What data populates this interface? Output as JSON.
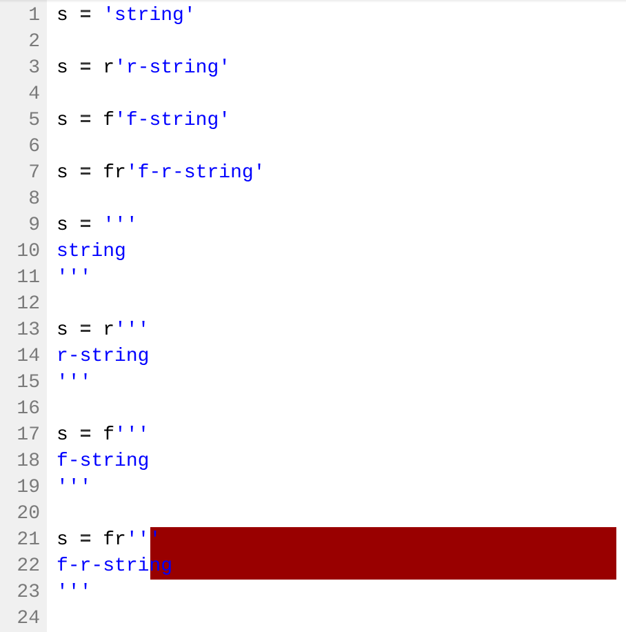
{
  "lineNumbers": [
    "1",
    "2",
    "3",
    "4",
    "5",
    "6",
    "7",
    "8",
    "9",
    "10",
    "11",
    "12",
    "13",
    "14",
    "15",
    "16",
    "17",
    "18",
    "19",
    "20",
    "21",
    "22",
    "23",
    "24"
  ],
  "code": {
    "line1": {
      "var": "s ",
      "op": "=",
      "prefix": " ",
      "str": "'string'"
    },
    "line3": {
      "var": "s ",
      "op": "=",
      "prefix": " r",
      "str": "'r-string'"
    },
    "line5": {
      "var": "s ",
      "op": "=",
      "prefix": " f",
      "str": "'f-string'"
    },
    "line7": {
      "var": "s ",
      "op": "=",
      "prefix": " fr",
      "str": "'f-r-string'"
    },
    "line9": {
      "var": "s ",
      "op": "=",
      "prefix": " ",
      "str": "'''"
    },
    "line10": {
      "str": "string"
    },
    "line11": {
      "str": "'''"
    },
    "line13": {
      "var": "s ",
      "op": "=",
      "prefix": " r",
      "str": "'''"
    },
    "line14": {
      "str": "r-string"
    },
    "line15": {
      "str": "'''"
    },
    "line17": {
      "var": "s ",
      "op": "=",
      "prefix": " f",
      "str": "'''"
    },
    "line18": {
      "str": "f-string"
    },
    "line19": {
      "str": "'''"
    },
    "line21": {
      "var": "s ",
      "op": "=",
      "prefix": " fr",
      "str": "'''"
    },
    "line22": {
      "str": "f-r-string"
    },
    "line23": {
      "str": "'''"
    }
  },
  "colors": {
    "string": "#0000ff",
    "text": "#000000",
    "gutterBg": "#f0f0f0",
    "gutterText": "#7a7a7a",
    "errorBg": "#990000"
  }
}
